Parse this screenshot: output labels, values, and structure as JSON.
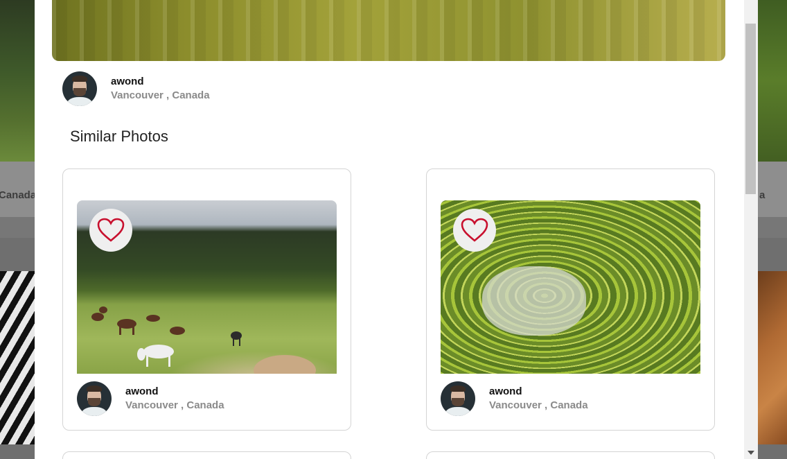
{
  "background": {
    "left_caption": "Canada",
    "right_caption": "a"
  },
  "modal": {
    "author": {
      "name": "awond",
      "location": "Vancouver , Canada"
    },
    "section_title": "Similar Photos",
    "cards": [
      {
        "name": "awond",
        "location": "Vancouver , Canada",
        "photo": "horses-grazing-meadow",
        "icon": "heart-icon"
      },
      {
        "name": "awond",
        "location": "Vancouver , Canada",
        "photo": "rice-terraces",
        "icon": "heart-icon"
      }
    ]
  },
  "colors": {
    "heart": "#c8102e",
    "modal_bg": "#ffffff",
    "overlay": "#6f6f6f"
  }
}
